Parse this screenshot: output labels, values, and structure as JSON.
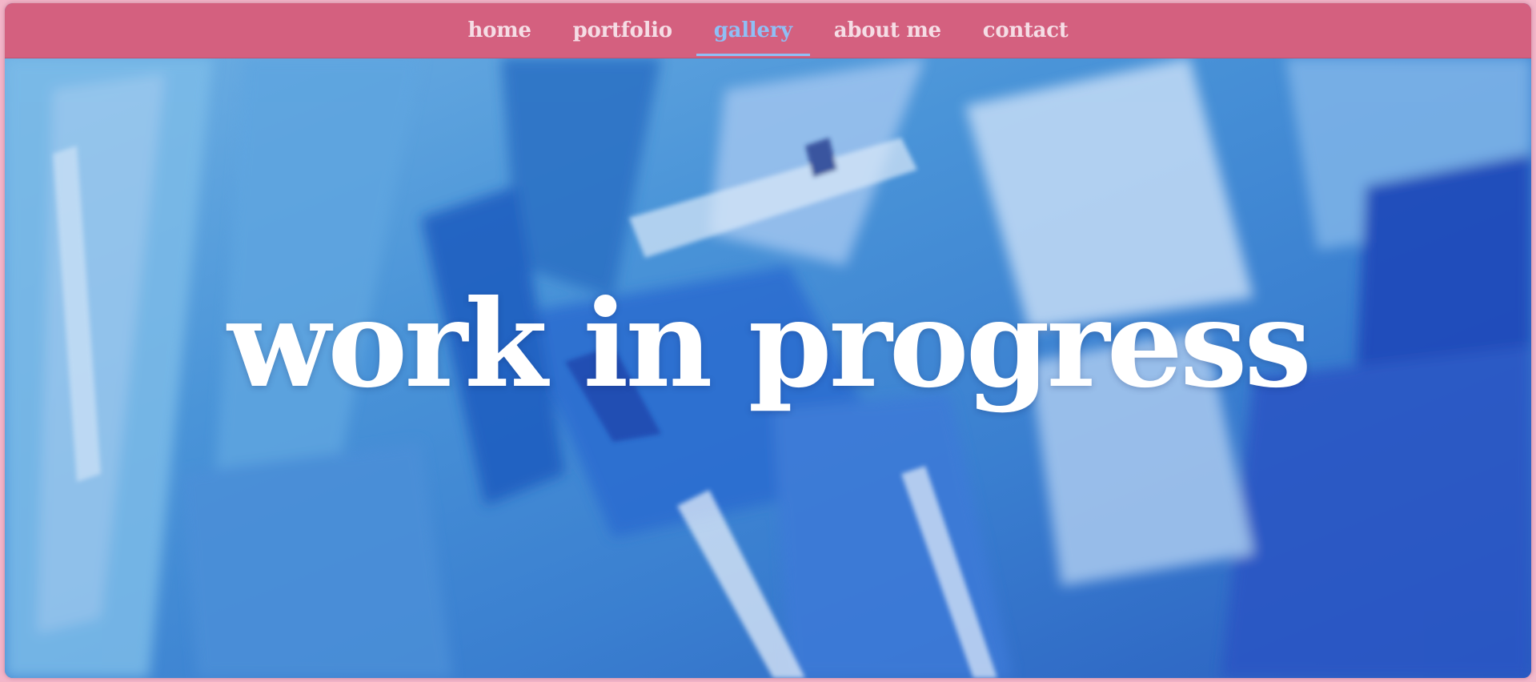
{
  "nav": {
    "items": [
      {
        "label": "home"
      },
      {
        "label": "portfolio"
      },
      {
        "label": "gallery"
      },
      {
        "label": "about me"
      },
      {
        "label": "contact"
      }
    ],
    "active_index": 2,
    "background_color": "#d4607f",
    "text_color": "#f5dde5",
    "active_color": "#8fbff5"
  },
  "hero": {
    "title": "work in progress",
    "background_description_icon": "abstract-blue-watercolor-painting",
    "title_color": "#ffffff"
  },
  "page": {
    "border_color": "#f3b6c9"
  }
}
